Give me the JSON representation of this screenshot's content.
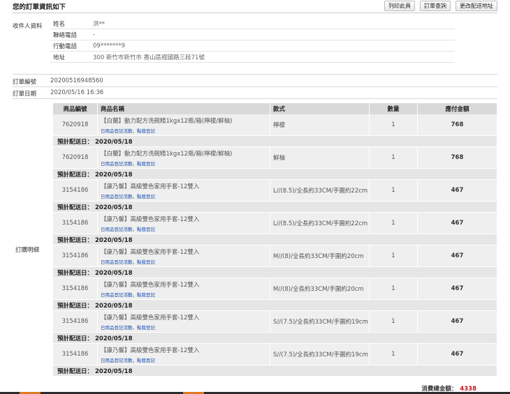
{
  "header": {
    "title": "您的訂單資訊如下",
    "buttons": [
      "列印此頁",
      "訂單查詢",
      "更改配送地址"
    ]
  },
  "recipient": {
    "section_label": "收件人資料",
    "fields": [
      {
        "label": "姓名",
        "value": "洪**"
      },
      {
        "label": "聯絡電話",
        "value": "-"
      },
      {
        "label": "行動電話",
        "value": "09*******9"
      },
      {
        "label": "地址",
        "value": "300 新竹市新竹市 香山區經國路三段71號"
      }
    ]
  },
  "order": {
    "number_label": "訂單編號",
    "number": "20200516948560",
    "date_label": "訂單日期",
    "date": "2020/05/16 16:36"
  },
  "details": {
    "section_label": "訂購明細",
    "columns": [
      "商品編號",
      "商品名稱",
      "款式",
      "數量",
      "應付金額"
    ],
    "event_text": "日用品登記活動，點我登記",
    "ship_label": "預計配送日：",
    "items": [
      {
        "code": "7620918",
        "name": "【白蘭】動力配方洗碗精1kgx12瓶/箱(檸檬/鮮柚)",
        "spec": "檸檬",
        "qty": "1",
        "amount": "768",
        "ship_date": "2020/05/18"
      },
      {
        "code": "7620918",
        "name": "【白蘭】動力配方洗碗精1kgx12瓶/箱(檸檬/鮮柚)",
        "spec": "鮮柚",
        "qty": "1",
        "amount": "768",
        "ship_date": "2020/05/18"
      },
      {
        "code": "3154186",
        "name": "【康乃馨】高級雙色家用手套-12雙入",
        "spec": "L//(8.5)/全長約33CM/手圍約22cm",
        "qty": "1",
        "amount": "467",
        "ship_date": "2020/05/18"
      },
      {
        "code": "3154186",
        "name": "【康乃馨】高級雙色家用手套-12雙入",
        "spec": "L//(8.5)/全長約33CM/手圍約22cm",
        "qty": "1",
        "amount": "467",
        "ship_date": "2020/05/18"
      },
      {
        "code": "3154186",
        "name": "【康乃馨】高級雙色家用手套-12雙入",
        "spec": "M//(8)/全長約33CM/手圍約20cm",
        "qty": "1",
        "amount": "467",
        "ship_date": "2020/05/18"
      },
      {
        "code": "3154186",
        "name": "【康乃馨】高級雙色家用手套-12雙入",
        "spec": "M//(8)/全長約33CM/手圍約20cm",
        "qty": "1",
        "amount": "467",
        "ship_date": "2020/05/18"
      },
      {
        "code": "3154186",
        "name": "【康乃馨】高級雙色家用手套-12雙入",
        "spec": "S//(7.5)/全長約33CM/手圍約19cm",
        "qty": "1",
        "amount": "467",
        "ship_date": "2020/05/18"
      },
      {
        "code": "3154186",
        "name": "【康乃馨】高級雙色家用手套-12雙入",
        "spec": "S//(7.5)/全長約33CM/手圍約19cm",
        "qty": "1",
        "amount": "467",
        "ship_date": "2020/05/18"
      }
    ]
  },
  "total": {
    "label": "消費總金額：",
    "amount": "4338"
  },
  "colors": {
    "total_amount": "#c4161c",
    "event_link": "#1a4fb3",
    "header_row": "#d9d9d9",
    "row_bg": "#efefef"
  }
}
